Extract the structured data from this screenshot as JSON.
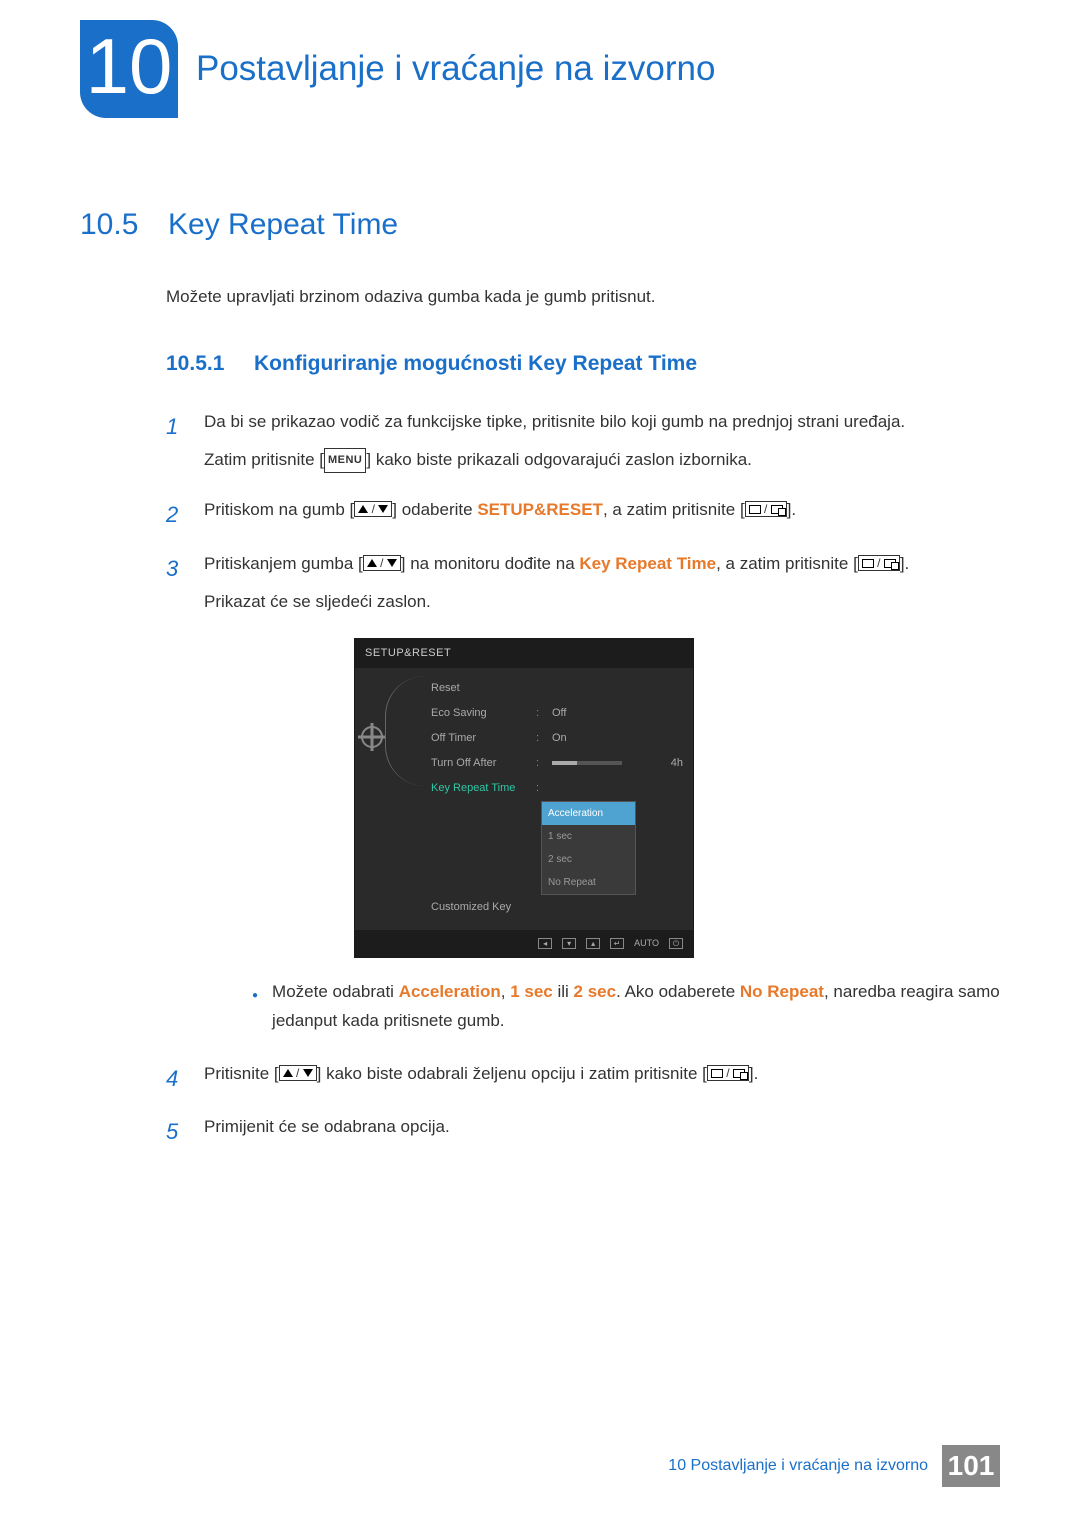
{
  "chapter": {
    "number": "10",
    "title": "Postavljanje i vraćanje na izvorno"
  },
  "section": {
    "number": "10.5",
    "title": "Key Repeat Time",
    "intro": "Možete upravljati brzinom odaziva gumba kada je gumb pritisnut."
  },
  "subsection": {
    "number": "10.5.1",
    "title": "Konfiguriranje mogućnosti Key Repeat Time"
  },
  "steps": [
    {
      "num": "1",
      "lines": [
        "Da bi se prikazao vodič za funkcijske tipke, pritisnite bilo koji gumb na prednjoj strani uređaja.",
        "Zatim pritisnite [|MENU|] kako biste prikazali odgovarajući zaslon izbornika."
      ]
    },
    {
      "num": "2",
      "lines": [
        "Pritiskom na gumb [|UPDOWN|] odaberite {SETUP&RESET}, a zatim pritisnite [|ENTER|]."
      ]
    },
    {
      "num": "3",
      "lines": [
        "Pritiskanjem gumba [|UPDOWN|] na monitoru dođite na {Key Repeat Time}, a zatim pritisnite [|ENTER|].",
        "Prikazat će se sljedeći zaslon."
      ]
    },
    {
      "num": "4",
      "lines": [
        "Pritisnite [|UPDOWN|] kako biste odabrali željenu opciju i zatim pritisnite [|ENTER|]."
      ]
    },
    {
      "num": "5",
      "lines": [
        "Primijenit će se odabrana opcija."
      ]
    }
  ],
  "note": {
    "parts": [
      "Možete odabrati ",
      "Acceleration",
      ", ",
      "1 sec",
      " ili ",
      "2 sec",
      ". Ako odaberete ",
      "No Repeat",
      ", naredba reagira samo jedanput kada pritisnete gumb."
    ]
  },
  "osd": {
    "title": "SETUP&RESET",
    "rows": [
      {
        "label": "Reset",
        "val": ""
      },
      {
        "label": "Eco Saving",
        "val": "Off"
      },
      {
        "label": "Off Timer",
        "val": "On"
      },
      {
        "label": "Turn Off After",
        "val": "slider",
        "after": "4h"
      },
      {
        "label": "Key Repeat Time",
        "val": "",
        "hl": true
      },
      {
        "label": "Customized Key",
        "val": ""
      }
    ],
    "submenu": [
      "Acceleration",
      "1 sec",
      "2 sec",
      "No Repeat"
    ],
    "submenu_selected": 0,
    "footer_auto": "AUTO"
  },
  "footer": {
    "chapter_ref": "10 Postavljanje i vraćanje na izvorno",
    "page": "101"
  }
}
